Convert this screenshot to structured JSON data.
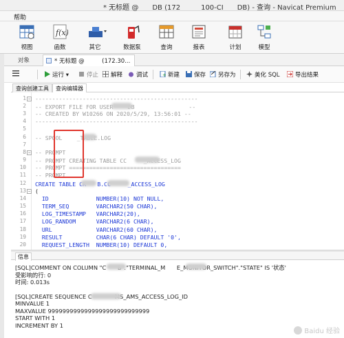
{
  "window": {
    "title": "* 无标题 @　　DB (172　　　100-CI　　DB) - 查询 - Navicat Premium"
  },
  "menu": {
    "help": "帮助"
  },
  "ribbon": [
    {
      "label": "视图",
      "icon": "view-grid-icon"
    },
    {
      "label": "函数",
      "icon": "function-icon"
    },
    {
      "label": "其它",
      "icon": "tools-icon"
    },
    {
      "label": "数据泵",
      "icon": "data-pump-icon"
    },
    {
      "label": "查询",
      "icon": "query-grid-icon"
    },
    {
      "label": "报表",
      "icon": "report-icon"
    },
    {
      "label": "计划",
      "icon": "calendar-icon"
    },
    {
      "label": "模型",
      "icon": "model-icon"
    }
  ],
  "object_tabs": {
    "objects": "对象",
    "query_tab": "* 无标题 @　　　(172.30..."
  },
  "toolbar": {
    "run": "运行",
    "stop": "停止",
    "explain": "解释",
    "debug": "调试",
    "new": "新建",
    "save": "保存",
    "save_as": "另存为",
    "beautify": "美化 SQL",
    "export": "导出结果"
  },
  "sub_tabs": {
    "builder": "查询创建工具",
    "editor": "查询编辑器"
  },
  "editor": {
    "line_numbers": [
      "1",
      "2",
      "3",
      "4",
      "5",
      "6",
      "7",
      "8",
      "9",
      "10",
      "11",
      "12",
      "13",
      "14",
      "15",
      "16",
      "17",
      "18",
      "19",
      "20"
    ],
    "lines": [
      "------------------------------------------------",
      "-- EXPORT FILE FOR USER 　　DB                --",
      "-- CREATED BY W10266 ON 2020/5/29, 13:56:01 --",
      "------------------------------------------------",
      "",
      "-- SPOOL 　　_TABLE.LOG",
      "",
      "-- PROMPT",
      "-- PROMPT CREATING TABLE CC　　　_ACCESS_LOG",
      "-- PROMPT =================================",
      "-- PROMPT",
      "CREATE TABLE CR　　B.CC　　　_ACCESS_LOG",
      "(",
      "  ID              NUMBER(10) NOT NULL,",
      "  TERM_SEQ        VARCHAR2(50 CHAR),",
      "  LOG_TIMESTAMP   VARCHAR2(20),",
      "  LOG_RANDOM      VARCHAR2(6 CHAR),",
      "  URL             VARCHAR2(60 CHAR),",
      "  RESULT          CHAR(6 CHAR) DEFAULT '0',",
      "  REQUEST_LENGTH  NUMBER(10) DEFAULT 0,"
    ]
  },
  "info_tab": "信息",
  "output": [
    "[SQL]COMMENT ON COLUMN \"C　　B\".\"TERMINAL_M　　E_MONITOR_SWITCH\".\"STATE\" IS '状态'",
    "受影响的行: 0",
    "时间: 0.013s",
    "",
    "[SQL]CREATE SEQUENCE C　　　　MS_AMS_ACCESS_LOG_ID",
    "MINVALUE 1",
    "MAXVALUE 9999999999999999999999999999",
    "START WITH 1",
    "INCREMENT BY 1"
  ],
  "watermark": "Baidu 经验",
  "colors": {
    "highlight_box": "#e0342b",
    "keyword": "#1a36d6",
    "comment": "#9b9b9b",
    "string": "#c0392b"
  }
}
